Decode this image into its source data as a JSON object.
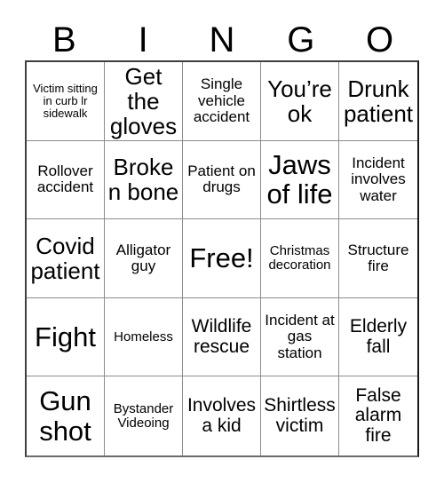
{
  "header": {
    "letters": [
      "B",
      "I",
      "N",
      "G",
      "O"
    ]
  },
  "grid": {
    "rows": 5,
    "columns": 5,
    "cells": [
      {
        "text": "Victim sitting in curb lr sidewalk",
        "size": "xs"
      },
      {
        "text": "Get the gloves",
        "size": "xl"
      },
      {
        "text": "Single vehicle accident",
        "size": "m"
      },
      {
        "text": "You’re ok",
        "size": "xl"
      },
      {
        "text": "Drunk patient",
        "size": "xl"
      },
      {
        "text": "Rollover accident",
        "size": "m"
      },
      {
        "text": "Broken bone",
        "size": "xl"
      },
      {
        "text": "Patient on drugs",
        "size": "m"
      },
      {
        "text": "Jaws of life",
        "size": "xxl"
      },
      {
        "text": "Incident involves water",
        "size": "m"
      },
      {
        "text": "Covid patient",
        "size": "xl"
      },
      {
        "text": "Alligator guy",
        "size": "m"
      },
      {
        "text": "Free!",
        "size": "xxl"
      },
      {
        "text": "Christmas decoration",
        "size": "s"
      },
      {
        "text": "Structure fire",
        "size": "m"
      },
      {
        "text": "Fight",
        "size": "xxl"
      },
      {
        "text": "Homeless",
        "size": "s"
      },
      {
        "text": "Wildlife rescue",
        "size": "l"
      },
      {
        "text": "Incident at gas station",
        "size": "m"
      },
      {
        "text": "Elderly fall",
        "size": "l"
      },
      {
        "text": "Gun shot",
        "size": "xxl"
      },
      {
        "text": "Bystander Videoing",
        "size": "s"
      },
      {
        "text": "Involves a kid",
        "size": "l"
      },
      {
        "text": "Shirtless victim",
        "size": "l"
      },
      {
        "text": "False alarm fire",
        "size": "l"
      }
    ]
  },
  "colors": {
    "text": "#000000",
    "background": "#ffffff",
    "cell_border": "#8c8c8c",
    "outer_border": "#1a1a1a"
  }
}
